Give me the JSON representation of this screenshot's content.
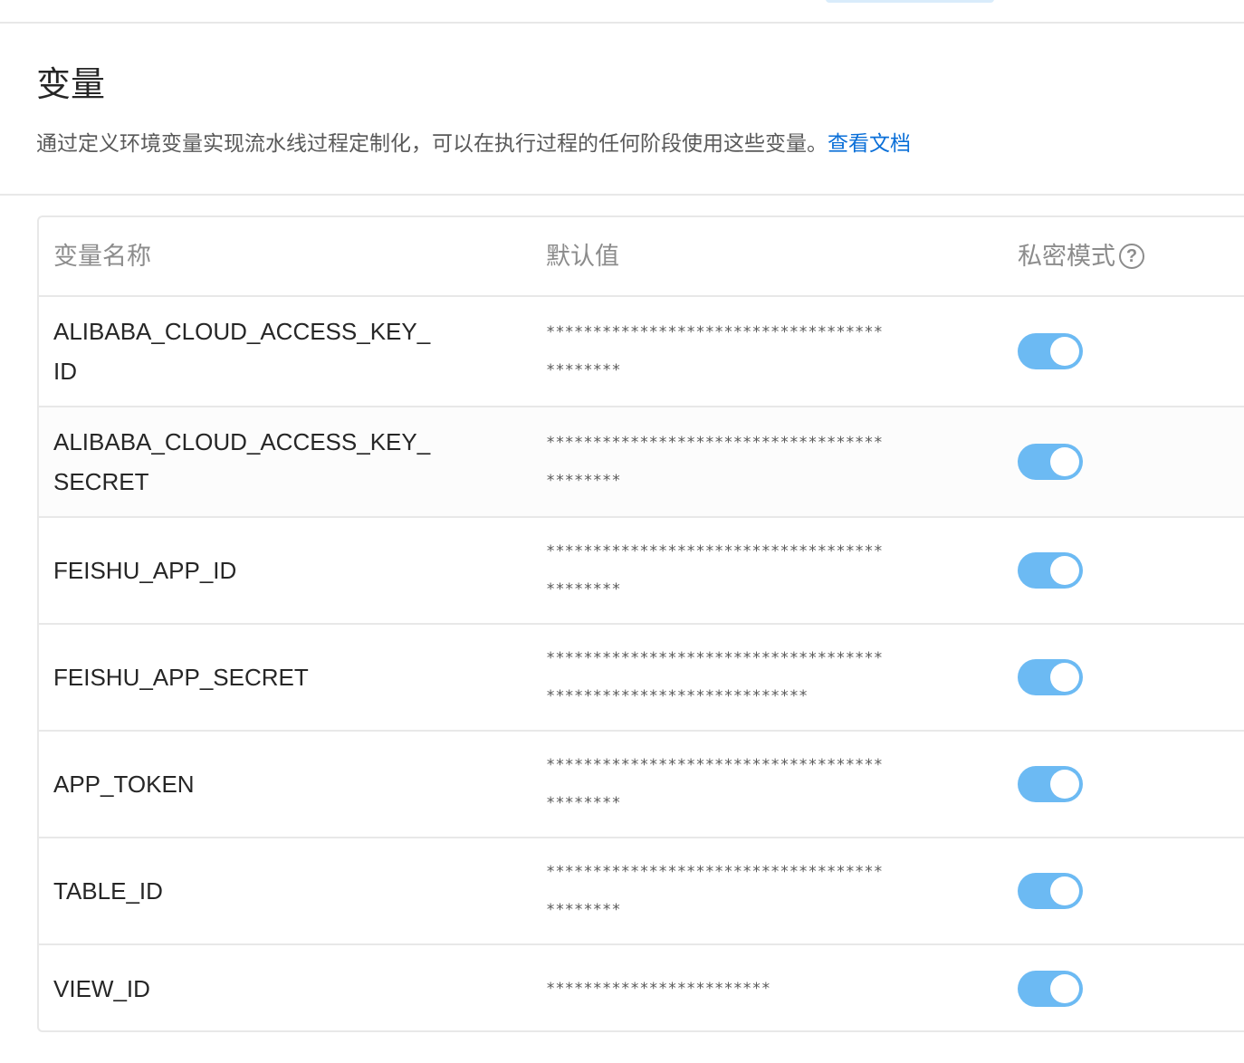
{
  "header": {
    "title": "变量",
    "description": "通过定义环境变量实现流水线过程定制化，可以在执行过程的任何阶段使用这些变量。",
    "doc_link": "查看文档"
  },
  "table": {
    "columns": {
      "name": "变量名称",
      "value": "默认值",
      "secret": "私密模式"
    },
    "help_icon": "question-circle-icon",
    "rows": [
      {
        "name": "ALIBABA_CLOUD_ACCESS_KEY_ID",
        "value": "********************************************",
        "secret_enabled": true
      },
      {
        "name": "ALIBABA_CLOUD_ACCESS_KEY_SECRET",
        "value": "********************************************",
        "secret_enabled": true
      },
      {
        "name": "FEISHU_APP_ID",
        "value": "********************************************",
        "secret_enabled": true
      },
      {
        "name": "FEISHU_APP_SECRET",
        "value": "****************************************************************",
        "secret_enabled": true
      },
      {
        "name": "APP_TOKEN",
        "value": "********************************************",
        "secret_enabled": true
      },
      {
        "name": "TABLE_ID",
        "value": "********************************************",
        "secret_enabled": true
      },
      {
        "name": "VIEW_ID",
        "value": "************************",
        "secret_enabled": true
      }
    ]
  },
  "colors": {
    "switch_on": "#6cbaf3",
    "link": "#0a6fd8"
  }
}
